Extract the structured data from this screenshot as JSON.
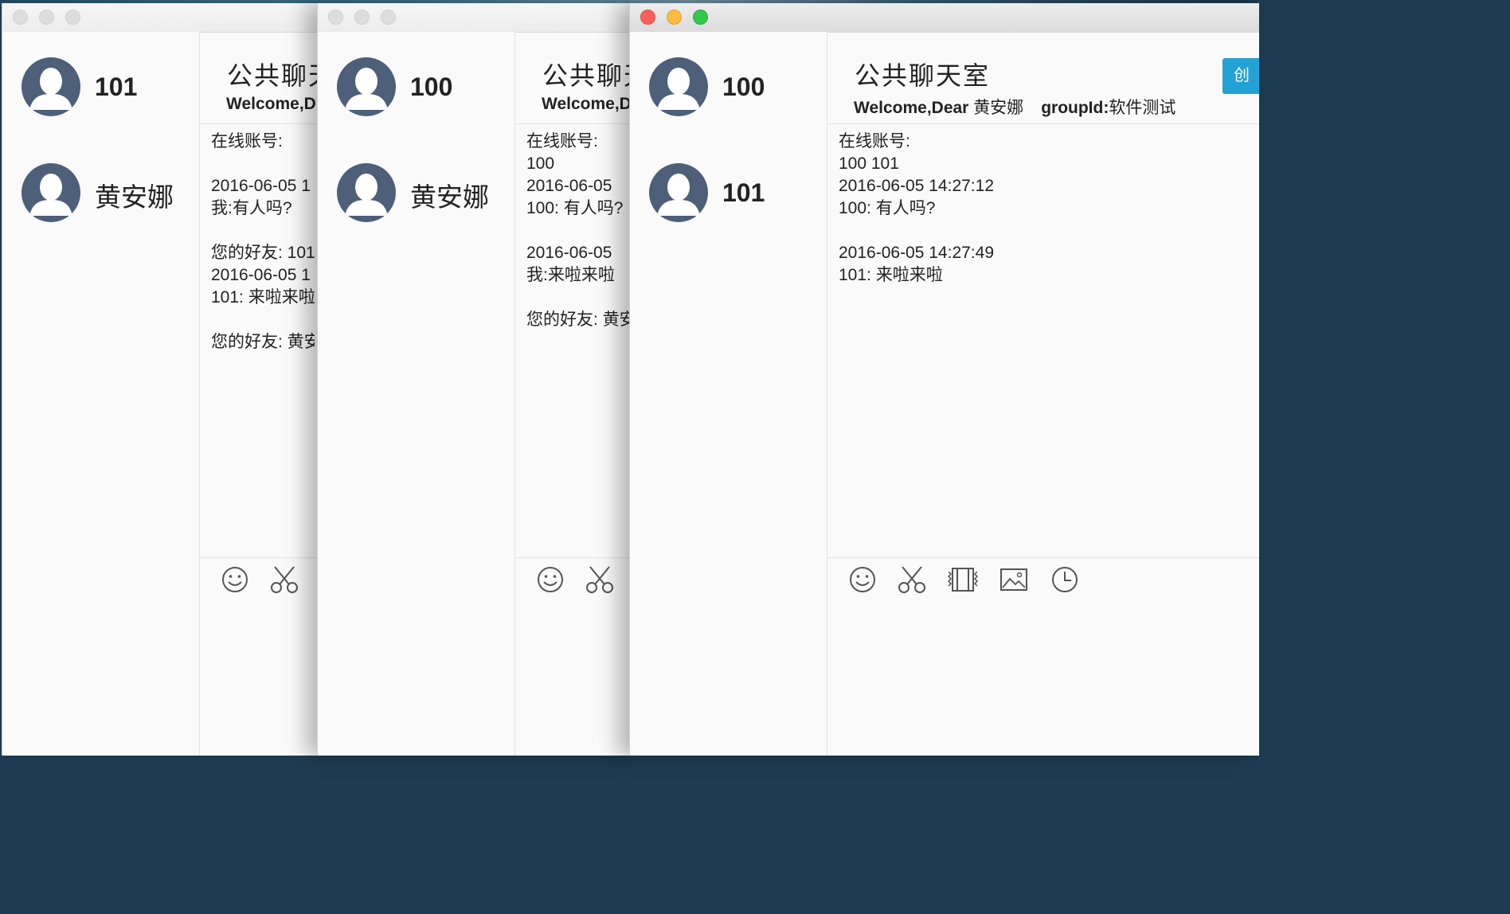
{
  "windows": [
    {
      "id": "w1",
      "contacts": [
        {
          "name": "101",
          "numeric": true
        },
        {
          "name": "黄安娜",
          "numeric": false
        }
      ],
      "chat": {
        "title": "公共聊天",
        "welcome_prefix": "Welcome,D",
        "messages": "在线账号:\n\n2016-06-05 1\n我:有人吗?\n\n您的好友: 101\n2016-06-05 1\n101: 来啦来啦\n\n您的好友: 黄安"
      },
      "toolbar": [
        "smiley-icon",
        "scissors-icon"
      ]
    },
    {
      "id": "w2",
      "contacts": [
        {
          "name": "100",
          "numeric": true
        },
        {
          "name": "黄安娜",
          "numeric": false
        }
      ],
      "chat": {
        "title": "公共聊天",
        "welcome_prefix": "Welcome,D",
        "messages": "在线账号:\n100\n2016-06-05\n100: 有人吗?\n\n2016-06-05\n我:来啦来啦\n\n您的好友: 黄安"
      },
      "toolbar": [
        "smiley-icon",
        "scissors-icon"
      ]
    },
    {
      "id": "w3",
      "contacts": [
        {
          "name": "100",
          "numeric": true
        },
        {
          "name": "101",
          "numeric": true
        }
      ],
      "chat": {
        "title": "公共聊天室",
        "welcome_prefix": "Welcome,Dear ",
        "welcome_name": "黄安娜",
        "groupid_label": "groupId:",
        "groupid_value": "软件测试",
        "create_button": "创",
        "messages": "在线账号:\n100 101\n2016-06-05 14:27:12\n100: 有人吗?\n\n2016-06-05 14:27:49\n101: 来啦来啦"
      },
      "toolbar": [
        "smiley-icon",
        "scissors-icon",
        "video-icon",
        "image-icon",
        "clock-icon"
      ]
    }
  ],
  "colors": {
    "avatar": "#4d5f79",
    "close": "#fc605b",
    "minimize": "#fdbc40",
    "zoom": "#34c84a",
    "accent": "#23a0d4"
  }
}
